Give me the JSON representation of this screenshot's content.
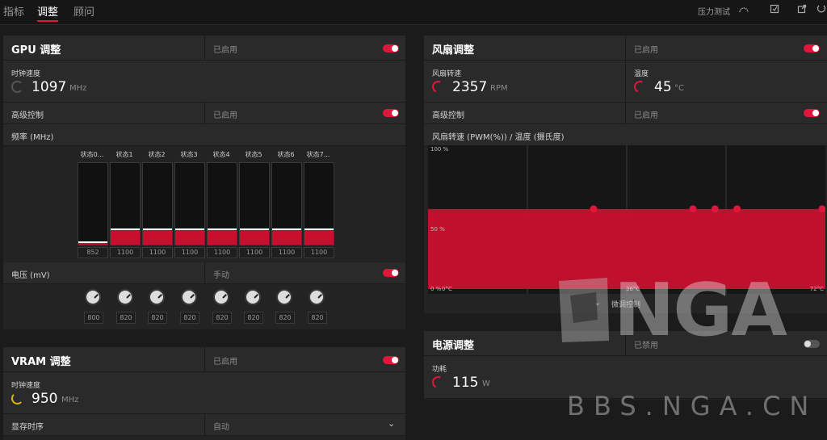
{
  "tabs": [
    {
      "label": "指标"
    },
    {
      "label": "调整"
    },
    {
      "label": "顾问"
    }
  ],
  "topbar": {
    "stress_test": "压力测试"
  },
  "gpu": {
    "title": "GPU 调整",
    "status": "已启用",
    "clock_label": "时钟速度",
    "clock_value": "1097",
    "clock_unit": "MHz",
    "advanced_label": "高级控制",
    "advanced_status": "已启用",
    "freq_label": "频率 (MHz)",
    "states": [
      {
        "label": "状态0...",
        "value": "852",
        "level": 0.02
      },
      {
        "label": "状态1",
        "value": "1100",
        "level": 0.18
      },
      {
        "label": "状态2",
        "value": "1100",
        "level": 0.18
      },
      {
        "label": "状态3",
        "value": "1100",
        "level": 0.18
      },
      {
        "label": "状态4",
        "value": "1100",
        "level": 0.18
      },
      {
        "label": "状态5",
        "value": "1100",
        "level": 0.18
      },
      {
        "label": "状态6",
        "value": "1100",
        "level": 0.18
      },
      {
        "label": "状态7...",
        "value": "1100",
        "level": 0.18
      }
    ],
    "voltage_label": "电压 (mV)",
    "voltage_mode": "手动",
    "voltages": [
      "800",
      "820",
      "820",
      "820",
      "820",
      "820",
      "820",
      "820"
    ]
  },
  "vram": {
    "title": "VRAM 调整",
    "status": "已启用",
    "clock_label": "时钟速度",
    "clock_value": "950",
    "clock_unit": "MHz",
    "timing_label": "显存时序",
    "timing_value": "自动"
  },
  "fan": {
    "title": "风扇调整",
    "status": "已启用",
    "speed_label": "风扇转速",
    "speed_value": "2357",
    "speed_unit": "RPM",
    "temp_label": "温度",
    "temp_value": "45",
    "temp_unit": "°C",
    "advanced_label": "高级控制",
    "advanced_status": "已启用",
    "chart_title": "风扇转速 (PWM(%)) / 温度 (摄氏度)",
    "fine_tune_label": "微调控制"
  },
  "power": {
    "title": "电源调整",
    "status": "已禁用",
    "power_label": "功耗",
    "power_value": "115",
    "power_unit": "W"
  },
  "watermark": {
    "logo": "NGA",
    "site": "BBS.NGA.CN"
  },
  "colors": {
    "accent": "#e0173c",
    "chart_fill": "#c8102e",
    "gauge_yellow": "#e0b800"
  },
  "chart_data": {
    "type": "area",
    "title": "风扇转速 (PWM(%)) / 温度 (摄氏度)",
    "x_ticks": [
      "0°C",
      "36°C",
      "72°C"
    ],
    "y_ticks": [
      "0 %",
      "50 %",
      "100 %"
    ],
    "xlim": [
      0,
      72
    ],
    "ylim": [
      0,
      100
    ],
    "points": [
      [
        0,
        57
      ],
      [
        30,
        57
      ],
      [
        48,
        57
      ],
      [
        52,
        57
      ],
      [
        56,
        57
      ],
      [
        72,
        57
      ]
    ]
  }
}
